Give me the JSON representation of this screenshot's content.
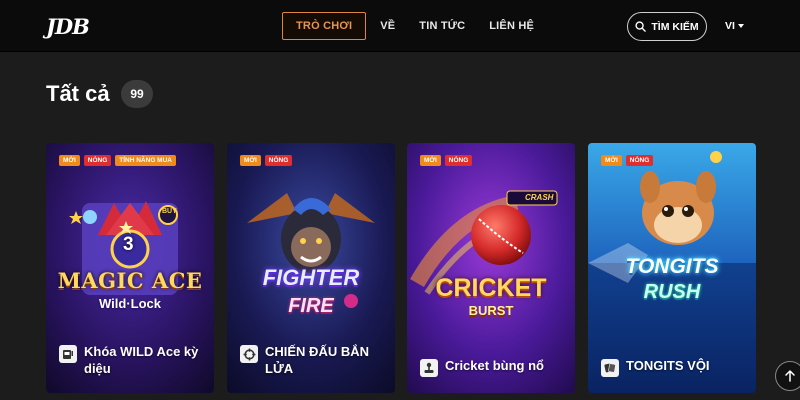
{
  "header": {
    "logo": "JDB",
    "nav": [
      {
        "label": "TRÒ CHƠI",
        "active": true
      },
      {
        "label": "VỀ"
      },
      {
        "label": "TIN TỨC"
      },
      {
        "label": "LIÊN HỆ"
      }
    ],
    "search_label": "TÌM KIẾM",
    "language": "VI"
  },
  "section": {
    "title": "Tất cả",
    "count": "99"
  },
  "games": [
    {
      "tags": [
        "MỚI",
        "NÓNG",
        "TÍNH NĂNG MUA"
      ],
      "art_title_1": "MAGIC ACE",
      "art_title_2": "Wild·Lock",
      "art_badge": "BUY",
      "art_number": "3",
      "name": "Khóa WILD Ace kỳ diệu",
      "icon": "slot-machine-icon"
    },
    {
      "tags": [
        "MỚI",
        "NÓNG"
      ],
      "art_title_1": "FIGHTER",
      "art_title_2": "FIRE",
      "name": "CHIẾN ĐẤU BẮN LỬA",
      "icon": "crosshair-icon"
    },
    {
      "tags": [
        "MỚI",
        "NÓNG"
      ],
      "art_title_1": "CRICKET",
      "art_title_2": "BURST",
      "art_badge": "CRASH",
      "name": "Cricket bùng nổ",
      "icon": "joystick-icon"
    },
    {
      "tags": [
        "MỚI",
        "NÓNG"
      ],
      "art_title_1": "TONGITS",
      "art_title_2": "RUSH",
      "name": "TONGITS VỘI",
      "icon": "cards-icon"
    }
  ],
  "colors": {
    "accent": "#e0853c",
    "tag_new": "#f08a1a",
    "tag_hot": "#e02e2e"
  }
}
